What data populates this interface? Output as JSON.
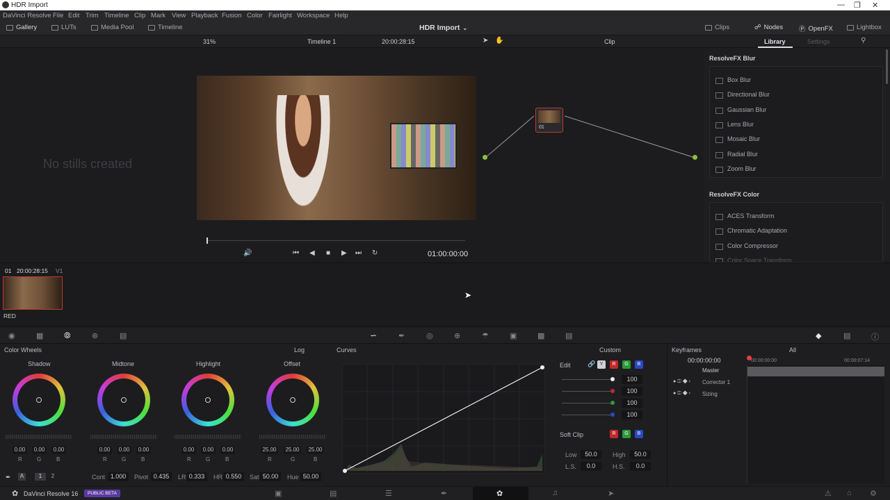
{
  "window": {
    "title": "HDR Import"
  },
  "menu": [
    "DaVinci Resolve",
    "File",
    "Edit",
    "Trim",
    "Timeline",
    "Clip",
    "Mark",
    "View",
    "Playback",
    "Fusion",
    "Color",
    "Fairlight",
    "Workspace",
    "Help"
  ],
  "topbar": {
    "gallery": "Gallery",
    "luts": "LUTs",
    "media_pool": "Media Pool",
    "timeline": "Timeline",
    "project": "HDR Import",
    "clips": "Clips",
    "nodes": "Nodes",
    "openfx": "OpenFX",
    "lightbox": "Lightbox"
  },
  "viewer": {
    "zoom": "31%",
    "timeline_name": "Timeline 1",
    "timecode": "20:00:28:15",
    "mode": "Clip",
    "playhead": "01:00:00:00"
  },
  "gallery": {
    "empty_text": "No stills created"
  },
  "library": {
    "tab_library": "Library",
    "tab_settings": "Settings",
    "blur_header": "ResolveFX Blur",
    "blur_items": [
      "Box Blur",
      "Directional Blur",
      "Gaussian Blur",
      "Lens Blur",
      "Mosaic Blur",
      "Radial Blur",
      "Zoom Blur"
    ],
    "color_header": "ResolveFX Color",
    "color_items": [
      "ACES Transform",
      "Chromatic Adaptation",
      "Color Compressor",
      "Color Space Transform"
    ]
  },
  "node": {
    "label": "01"
  },
  "clipstrip": {
    "index": "01",
    "timecode": "20:00:28:15",
    "track": "V1",
    "clip_name": "RED"
  },
  "colorwheels": {
    "title": "Color Wheels",
    "mode": "Log",
    "wheels": [
      {
        "name": "Shadow",
        "values": [
          "0.00",
          "0.00",
          "0.00"
        ]
      },
      {
        "name": "Midtone",
        "values": [
          "0.00",
          "0.00",
          "0.00"
        ]
      },
      {
        "name": "Highlight",
        "values": [
          "0.00",
          "0.00",
          "0.00"
        ]
      },
      {
        "name": "Offset",
        "values": [
          "25.00",
          "25.00",
          "25.00"
        ]
      }
    ],
    "channels": [
      "R",
      "G",
      "B"
    ],
    "pages": [
      "1",
      "2"
    ],
    "adjust": {
      "cont_label": "Cont",
      "cont": "1.000",
      "pivot_label": "Pivot",
      "pivot": "0.435",
      "lr_label": "LR",
      "lr": "0.333",
      "hr_label": "HR",
      "hr": "0.550",
      "sat_label": "Sat",
      "sat": "50.00",
      "hue_label": "Hue",
      "hue": "50.00"
    }
  },
  "curves": {
    "title": "Curves",
    "preset": "Custom",
    "edit_label": "Edit",
    "edit_values": [
      "100",
      "100",
      "100",
      "100"
    ],
    "softclip_label": "Soft Clip",
    "low_label": "Low",
    "low": "50.0",
    "high_label": "High",
    "high": "50.0",
    "ls_label": "L.S.",
    "ls": "0.0",
    "hs_label": "H.S.",
    "hs": "0.0",
    "channels": {
      "y": "Y",
      "r": "R",
      "g": "G",
      "b": "B"
    }
  },
  "keyframes": {
    "title": "Keyframes",
    "filter": "All",
    "timecode": "00:00:00:00",
    "ruler_start": "00:00:00:00",
    "ruler_end": "00:00:07:14",
    "rows": [
      "Master",
      "Corrector 1",
      "Sizing"
    ]
  },
  "footer": {
    "app": "DaVinci Resolve 16",
    "badge": "PUBLIC BETA"
  }
}
